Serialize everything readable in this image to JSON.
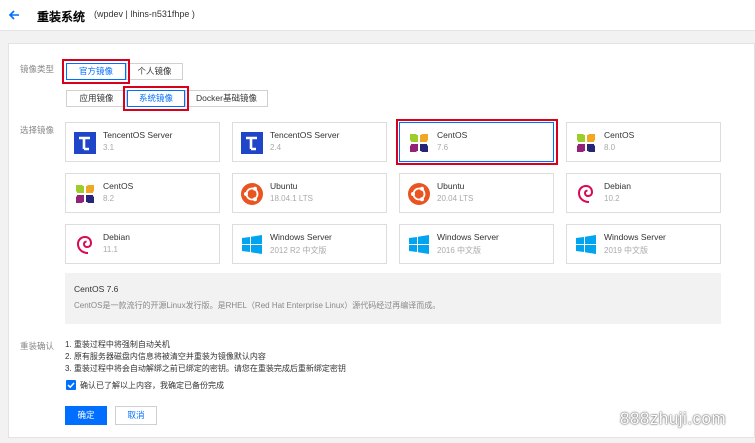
{
  "header": {
    "title": "重装系统",
    "subtitle": "(wpdev | lhins-n531fhpe )"
  },
  "image_type": {
    "label": "镜像类型",
    "tabs": [
      {
        "label": "官方镜像",
        "active": true
      },
      {
        "label": "个人镜像",
        "active": false
      }
    ],
    "subtabs": [
      {
        "label": "应用镜像",
        "active": false
      },
      {
        "label": "系统镜像",
        "active": true
      },
      {
        "label": "Docker基础镜像",
        "active": false
      }
    ]
  },
  "select_image": {
    "label": "选择镜像",
    "cards": [
      {
        "name": "TencentOS Server",
        "version": "3.1",
        "icon": "tencentos-icon",
        "selected": false
      },
      {
        "name": "TencentOS Server",
        "version": "2.4",
        "icon": "tencentos-icon",
        "selected": false
      },
      {
        "name": "CentOS",
        "version": "7.6",
        "icon": "centos-icon",
        "selected": true
      },
      {
        "name": "CentOS",
        "version": "8.0",
        "icon": "centos-icon",
        "selected": false
      },
      {
        "name": "CentOS",
        "version": "8.2",
        "icon": "centos-icon",
        "selected": false
      },
      {
        "name": "Ubuntu",
        "version": "18.04.1 LTS",
        "icon": "ubuntu-icon",
        "selected": false
      },
      {
        "name": "Ubuntu",
        "version": "20.04 LTS",
        "icon": "ubuntu-icon",
        "selected": false
      },
      {
        "name": "Debian",
        "version": "10.2",
        "icon": "debian-icon",
        "selected": false
      },
      {
        "name": "Debian",
        "version": "11.1",
        "icon": "debian-icon",
        "selected": false
      },
      {
        "name": "Windows Server",
        "version": "2012 R2 中文版",
        "icon": "windows-icon",
        "selected": false
      },
      {
        "name": "Windows Server",
        "version": "2016 中文版",
        "icon": "windows-icon",
        "selected": false
      },
      {
        "name": "Windows Server",
        "version": "2019 中文版",
        "icon": "windows-icon",
        "selected": false
      }
    ]
  },
  "description": {
    "title": "CentOS 7.6",
    "text": "CentOS是一款流行的开源Linux发行版。是RHEL（Red Hat Enterprise Linux）源代码经过再编译而成。"
  },
  "confirm": {
    "label": "重装确认",
    "lines": [
      "1. 重装过程中将强制自动关机",
      "2. 原有服务器磁盘内信息将被清空并重装为镜像默认内容",
      "3. 重装过程中将会自动解绑之前已绑定的密钥。请您在重装完成后重新绑定密钥"
    ],
    "checkbox_label": "确认已了解以上内容，我确定已备份完成",
    "checkbox_checked": true
  },
  "buttons": {
    "confirm": "确定",
    "cancel": "取消"
  },
  "watermark": "888zhuji.com",
  "colors": {
    "accent": "#006eff",
    "highlight_outline": "#d9001b"
  }
}
